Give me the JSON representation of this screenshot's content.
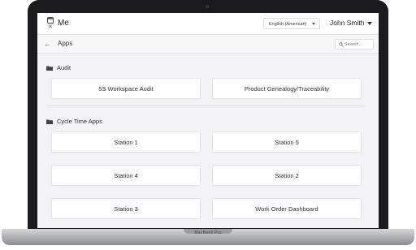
{
  "header": {
    "title": "Me",
    "language": "English (American)",
    "user": "John Smith"
  },
  "subheader": {
    "title": "Apps",
    "search_placeholder": "Search..."
  },
  "sections": [
    {
      "title": "Audit",
      "apps": [
        "5S Workspace Audit",
        "Product Genealogy/Traceability"
      ]
    },
    {
      "title": "Cycle Time Apps",
      "apps": [
        "Station 1",
        "Station 5",
        "Station 4",
        "Station 2",
        "Station 3",
        "Work Order Dashboard"
      ]
    }
  ],
  "device": {
    "model": "MacBook Pro"
  }
}
